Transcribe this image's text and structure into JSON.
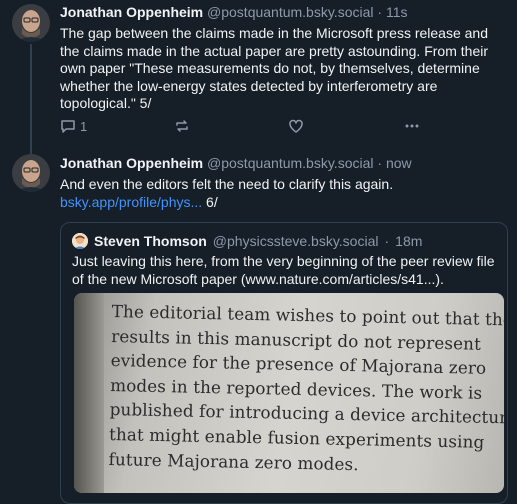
{
  "post1": {
    "author": "Jonathan Oppenheim",
    "handle": "@postquantum.bsky.social",
    "sep": "·",
    "time": "11s",
    "text": "The gap between the claims made in the Microsoft press release and the claims made in the actual paper are pretty astounding. From their own paper \"These measurements do not, by themselves, determine whether the low-energy states detected by interferometry are topological.\" 5/",
    "reply_count": "1"
  },
  "post2": {
    "author": "Jonathan Oppenheim",
    "handle": "@postquantum.bsky.social",
    "sep": "·",
    "time": "now",
    "text_before": "And even the editors felt the need to clarify this again. ",
    "link": "bsky.app/profile/phys...",
    "text_after": " 6/"
  },
  "quote": {
    "author": "Steven Thomson",
    "handle": "@physicssteve.bsky.social",
    "sep": "·",
    "time": "18m",
    "text": "Just leaving this here, from the very beginning of the peer review file of the new Microsoft paper (www.nature.com/articles/s41...).",
    "image_lines": [
      "The editorial team wishes to point out that the",
      "results in this manuscript do not represent",
      "evidence for the presence of Majorana zero",
      "modes in the reported devices. The work is",
      "published for introducing a device architecture",
      "that might enable fusion experiments using",
      "future Majorana zero modes."
    ]
  },
  "icons": {
    "reply": "reply-icon",
    "repost": "repost-icon",
    "like": "heart-icon",
    "more": "more-icon"
  },
  "colors": {
    "background": "#161e27",
    "link": "#3f94ff",
    "muted": "#8d9aa9"
  }
}
